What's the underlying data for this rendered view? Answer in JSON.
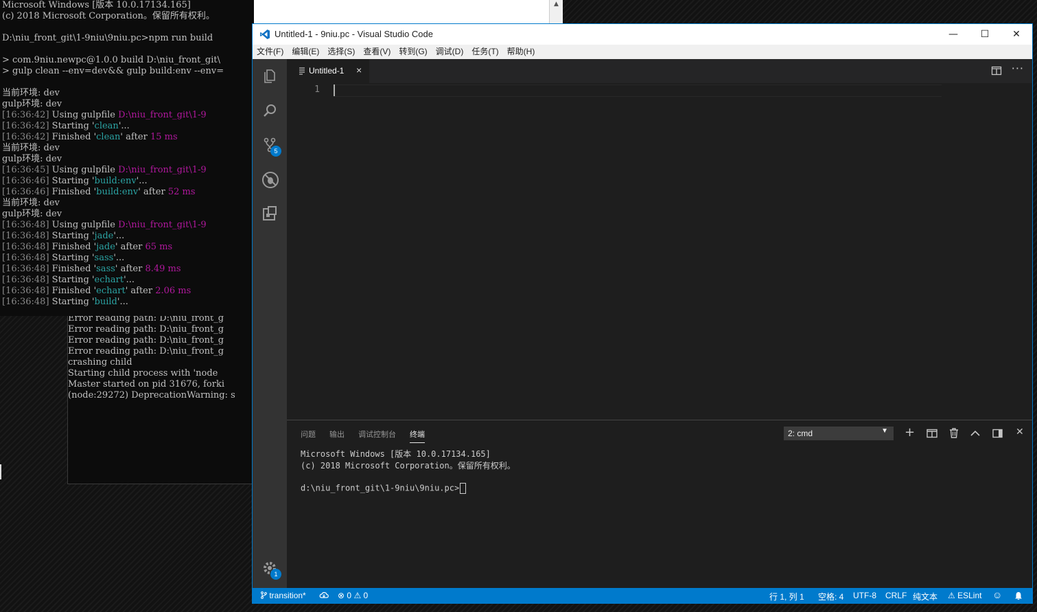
{
  "cmd_back": {
    "lines": [
      "Error reading path: D:\\niu_front_g",
      "Error reading path: D:\\niu_front_g",
      "Error reading path: D:\\niu_front_g",
      "Error reading path: D:\\niu_front_g",
      "crashing child",
      "Starting child process with 'node",
      "Master started on pid 31676, forki",
      "(node:29272) DeprecationWarning: s"
    ]
  },
  "cmd_front": {
    "header1": "Microsoft Windows [版本 10.0.17134.165]",
    "header2": "(c) 2018 Microsoft Corporation。保留所有权利。",
    "prompt": "D:\\niu_front_git\\1-9niu\\9niu.pc>npm run build",
    "npm1": "> com.9niu.newpc@1.0.0 build D:\\niu_front_git\\",
    "npm2": "> gulp clean --env=dev&& gulp build:env --env=",
    "log": [
      {
        "type": "plain",
        "text": "当前环境: dev"
      },
      {
        "type": "plain",
        "text": "gulp环境: dev"
      },
      {
        "type": "gulp",
        "ts": "[16:36:42]",
        "verb": " Using gulpfile ",
        "name": "D:\\niu_front_git\\1-9",
        "tail": "",
        "ms": ""
      },
      {
        "type": "gulp",
        "ts": "[16:36:42]",
        "verb": " Starting '",
        "name": "clean",
        "tail": "'...",
        "ms": ""
      },
      {
        "type": "gulp",
        "ts": "[16:36:42]",
        "verb": " Finished '",
        "name": "clean",
        "tail": "' after ",
        "ms": "15 ms"
      },
      {
        "type": "plain",
        "text": "当前环境: dev"
      },
      {
        "type": "plain",
        "text": "gulp环境: dev"
      },
      {
        "type": "gulp",
        "ts": "[16:36:45]",
        "verb": " Using gulpfile ",
        "name": "D:\\niu_front_git\\1-9",
        "tail": "",
        "ms": ""
      },
      {
        "type": "gulp",
        "ts": "[16:36:46]",
        "verb": " Starting '",
        "name": "build:env",
        "tail": "'...",
        "ms": ""
      },
      {
        "type": "gulp",
        "ts": "[16:36:46]",
        "verb": " Finished '",
        "name": "build:env",
        "tail": "' after ",
        "ms": "52 ms"
      },
      {
        "type": "plain",
        "text": "当前环境: dev"
      },
      {
        "type": "plain",
        "text": "gulp环境: dev"
      },
      {
        "type": "gulp",
        "ts": "[16:36:48]",
        "verb": " Using gulpfile ",
        "name": "D:\\niu_front_git\\1-9",
        "tail": "",
        "ms": ""
      },
      {
        "type": "gulp",
        "ts": "[16:36:48]",
        "verb": " Starting '",
        "name": "jade",
        "tail": "'...",
        "ms": ""
      },
      {
        "type": "gulp",
        "ts": "[16:36:48]",
        "verb": " Finished '",
        "name": "jade",
        "tail": "' after ",
        "ms": "65 ms"
      },
      {
        "type": "gulp",
        "ts": "[16:36:48]",
        "verb": " Starting '",
        "name": "sass",
        "tail": "'...",
        "ms": ""
      },
      {
        "type": "gulp",
        "ts": "[16:36:48]",
        "verb": " Finished '",
        "name": "sass",
        "tail": "' after ",
        "ms": "8.49 ms"
      },
      {
        "type": "gulp",
        "ts": "[16:36:48]",
        "verb": " Starting '",
        "name": "echart",
        "tail": "'...",
        "ms": ""
      },
      {
        "type": "gulp",
        "ts": "[16:36:48]",
        "verb": " Finished '",
        "name": "echart",
        "tail": "' after ",
        "ms": "2.06 ms"
      },
      {
        "type": "gulp",
        "ts": "[16:36:48]",
        "verb": " Starting '",
        "name": "build",
        "tail": "'...",
        "ms": ""
      }
    ],
    "scroll_up_glyph": "▲"
  },
  "vscode": {
    "title": "Untitled-1 - 9niu.pc - Visual Studio Code",
    "window_controls": {
      "minimize": "—",
      "maximize": "☐",
      "close": "✕"
    },
    "menu": [
      "文件(F)",
      "编辑(E)",
      "选择(S)",
      "查看(V)",
      "转到(G)",
      "调试(D)",
      "任务(T)",
      "帮助(H)"
    ],
    "activity": {
      "scm_badge": "5",
      "settings_badge": "1"
    },
    "tab": {
      "label": "Untitled-1",
      "close": "×"
    },
    "more_glyph": "···",
    "line_number": "1",
    "panel": {
      "tabs": [
        "问题",
        "输出",
        "调试控制台",
        "终端"
      ],
      "active_tab_index": 3,
      "terminal_select": "2: cmd",
      "terminal_lines": [
        "Microsoft Windows [版本 10.0.17134.165]",
        "(c) 2018 Microsoft Corporation。保留所有权利。",
        "",
        "d:\\niu_front_git\\1-9niu\\9niu.pc>"
      ],
      "icons": {
        "add": "+",
        "close": "✕",
        "maximize": "︿"
      }
    },
    "status": {
      "branch": "transition*",
      "errors": "0",
      "warnings": "0",
      "position": "行 1, 列 1",
      "indent": "空格: 4",
      "encoding": "UTF-8",
      "eol": "CRLF",
      "language": "纯文本",
      "eslint": "ESLint"
    },
    "colors": {
      "accent": "#007acc",
      "activity_bg": "#333333",
      "editor_bg": "#1e1e1e"
    }
  }
}
